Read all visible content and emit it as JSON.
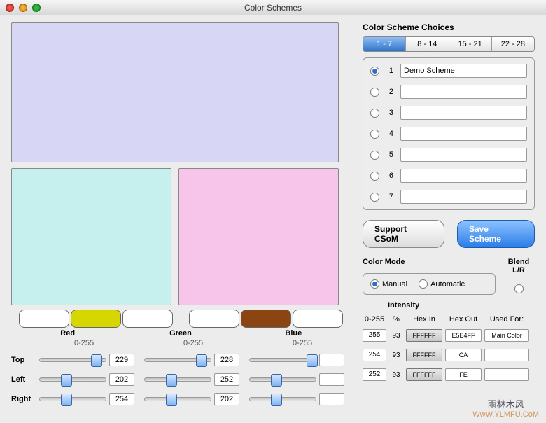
{
  "window": {
    "title": "Color Schemes"
  },
  "choices": {
    "title": "Color Scheme Choices",
    "tabs": [
      "1 - 7",
      "8 - 14",
      "15 - 21",
      "22 - 28"
    ],
    "items": [
      {
        "n": "1",
        "name": "Demo Scheme",
        "selected": true
      },
      {
        "n": "2",
        "name": "",
        "selected": false
      },
      {
        "n": "3",
        "name": "",
        "selected": false
      },
      {
        "n": "4",
        "name": "",
        "selected": false
      },
      {
        "n": "5",
        "name": "",
        "selected": false
      },
      {
        "n": "6",
        "name": "",
        "selected": false
      },
      {
        "n": "7",
        "name": "",
        "selected": false
      }
    ]
  },
  "buttons": {
    "support": "Support CSoM",
    "save": "Save Scheme"
  },
  "mode": {
    "title": "Color Mode",
    "manual": "Manual",
    "auto": "Automatic",
    "blend": "Blend L/R"
  },
  "rgb": {
    "red": "Red",
    "green": "Green",
    "blue": "Blue",
    "range": "0-255"
  },
  "rows": {
    "top": {
      "label": "Top",
      "r": "229",
      "g": "228",
      "b": ""
    },
    "left": {
      "label": "Left",
      "r": "202",
      "g": "252",
      "b": ""
    },
    "right": {
      "label": "Right",
      "r": "254",
      "g": "202",
      "b": ""
    }
  },
  "intensity": {
    "title": "Intensity",
    "cols": {
      "range": "0-255",
      "pct": "%",
      "hexin": "Hex In",
      "hexout": "Hex Out",
      "used": "Used For:"
    },
    "rows": [
      {
        "val": "255",
        "pct": "93",
        "hexin": "FFFFFF",
        "hexout": "E5E4FF",
        "used": "Main Color"
      },
      {
        "val": "254",
        "pct": "93",
        "hexin": "FFFFFF",
        "hexout": "CA",
        "used": ""
      },
      {
        "val": "252",
        "pct": "93",
        "hexin": "FFFFFF",
        "hexout": "FE",
        "used": ""
      }
    ]
  },
  "colors": {
    "top": "#d7d7f5",
    "left": "#c5f0ed",
    "right": "#f6c5e9"
  },
  "watermark": {
    "line1": "雨林木风",
    "line2": "WwW.YLMFU.CoM"
  }
}
